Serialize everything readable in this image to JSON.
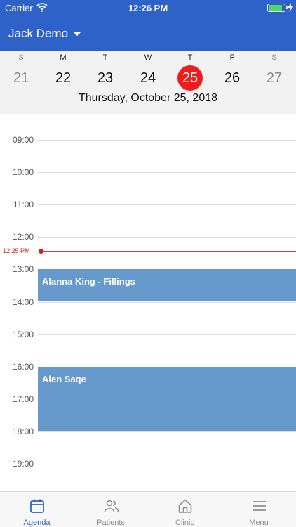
{
  "status_bar": {
    "carrier": "Carrier",
    "time": "12:26 PM",
    "battery_level": 0.85
  },
  "header": {
    "user_name": "Jack Demo"
  },
  "week": {
    "days": [
      {
        "letter": "S",
        "num": "21",
        "weekend": true
      },
      {
        "letter": "M",
        "num": "22",
        "weekend": false
      },
      {
        "letter": "T",
        "num": "23",
        "weekend": false
      },
      {
        "letter": "W",
        "num": "24",
        "weekend": false
      },
      {
        "letter": "T",
        "num": "25",
        "weekend": false,
        "selected": true
      },
      {
        "letter": "F",
        "num": "26",
        "weekend": false
      },
      {
        "letter": "S",
        "num": "27",
        "weekend": true
      }
    ],
    "full_date": "Thursday, October 25, 2018"
  },
  "agenda": {
    "hours": [
      "09:00",
      "10:00",
      "11:00",
      "12:00",
      "13:00",
      "14:00",
      "15:00",
      "16:00",
      "17:00",
      "18:00",
      "19:00"
    ],
    "now": {
      "label": "12:25 PM",
      "time": "12:25"
    },
    "events": [
      {
        "title": "Alanna King - Fillings",
        "start": "13:00",
        "end": "14:00"
      },
      {
        "title": "Alen Saqe",
        "start": "16:00",
        "end": "18:00"
      }
    ]
  },
  "tabs": [
    {
      "label": "Agenda",
      "icon": "calendar-icon",
      "active": true
    },
    {
      "label": "Patients",
      "icon": "patients-icon",
      "active": false
    },
    {
      "label": "Clinic",
      "icon": "clinic-icon",
      "active": false
    },
    {
      "label": "Menu",
      "icon": "menu-icon",
      "active": false
    }
  ],
  "colors": {
    "brand": "#2f62c8",
    "event": "#6699cc",
    "today": "#ee1c1c",
    "now_line": "#d41d1d"
  }
}
